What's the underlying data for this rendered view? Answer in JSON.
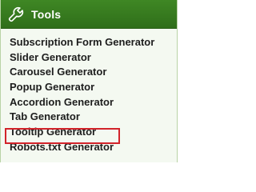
{
  "header": {
    "icon": "wrench-icon",
    "title": "Tools"
  },
  "menu": {
    "items": [
      {
        "label": "Subscription Form Generator"
      },
      {
        "label": "Slider Generator"
      },
      {
        "label": "Carousel Generator"
      },
      {
        "label": "Popup Generator"
      },
      {
        "label": "Accordion Generator"
      },
      {
        "label": "Tab Generator"
      },
      {
        "label": "Tooltip Generator",
        "highlighted": true
      },
      {
        "label": "Robots.txt Generator"
      }
    ]
  },
  "colors": {
    "header_background": "#3a7f22",
    "header_text": "#ffffff",
    "panel_background": "#f4f9f1",
    "item_text": "#1d1d1d",
    "highlight_border": "#d2232a"
  }
}
